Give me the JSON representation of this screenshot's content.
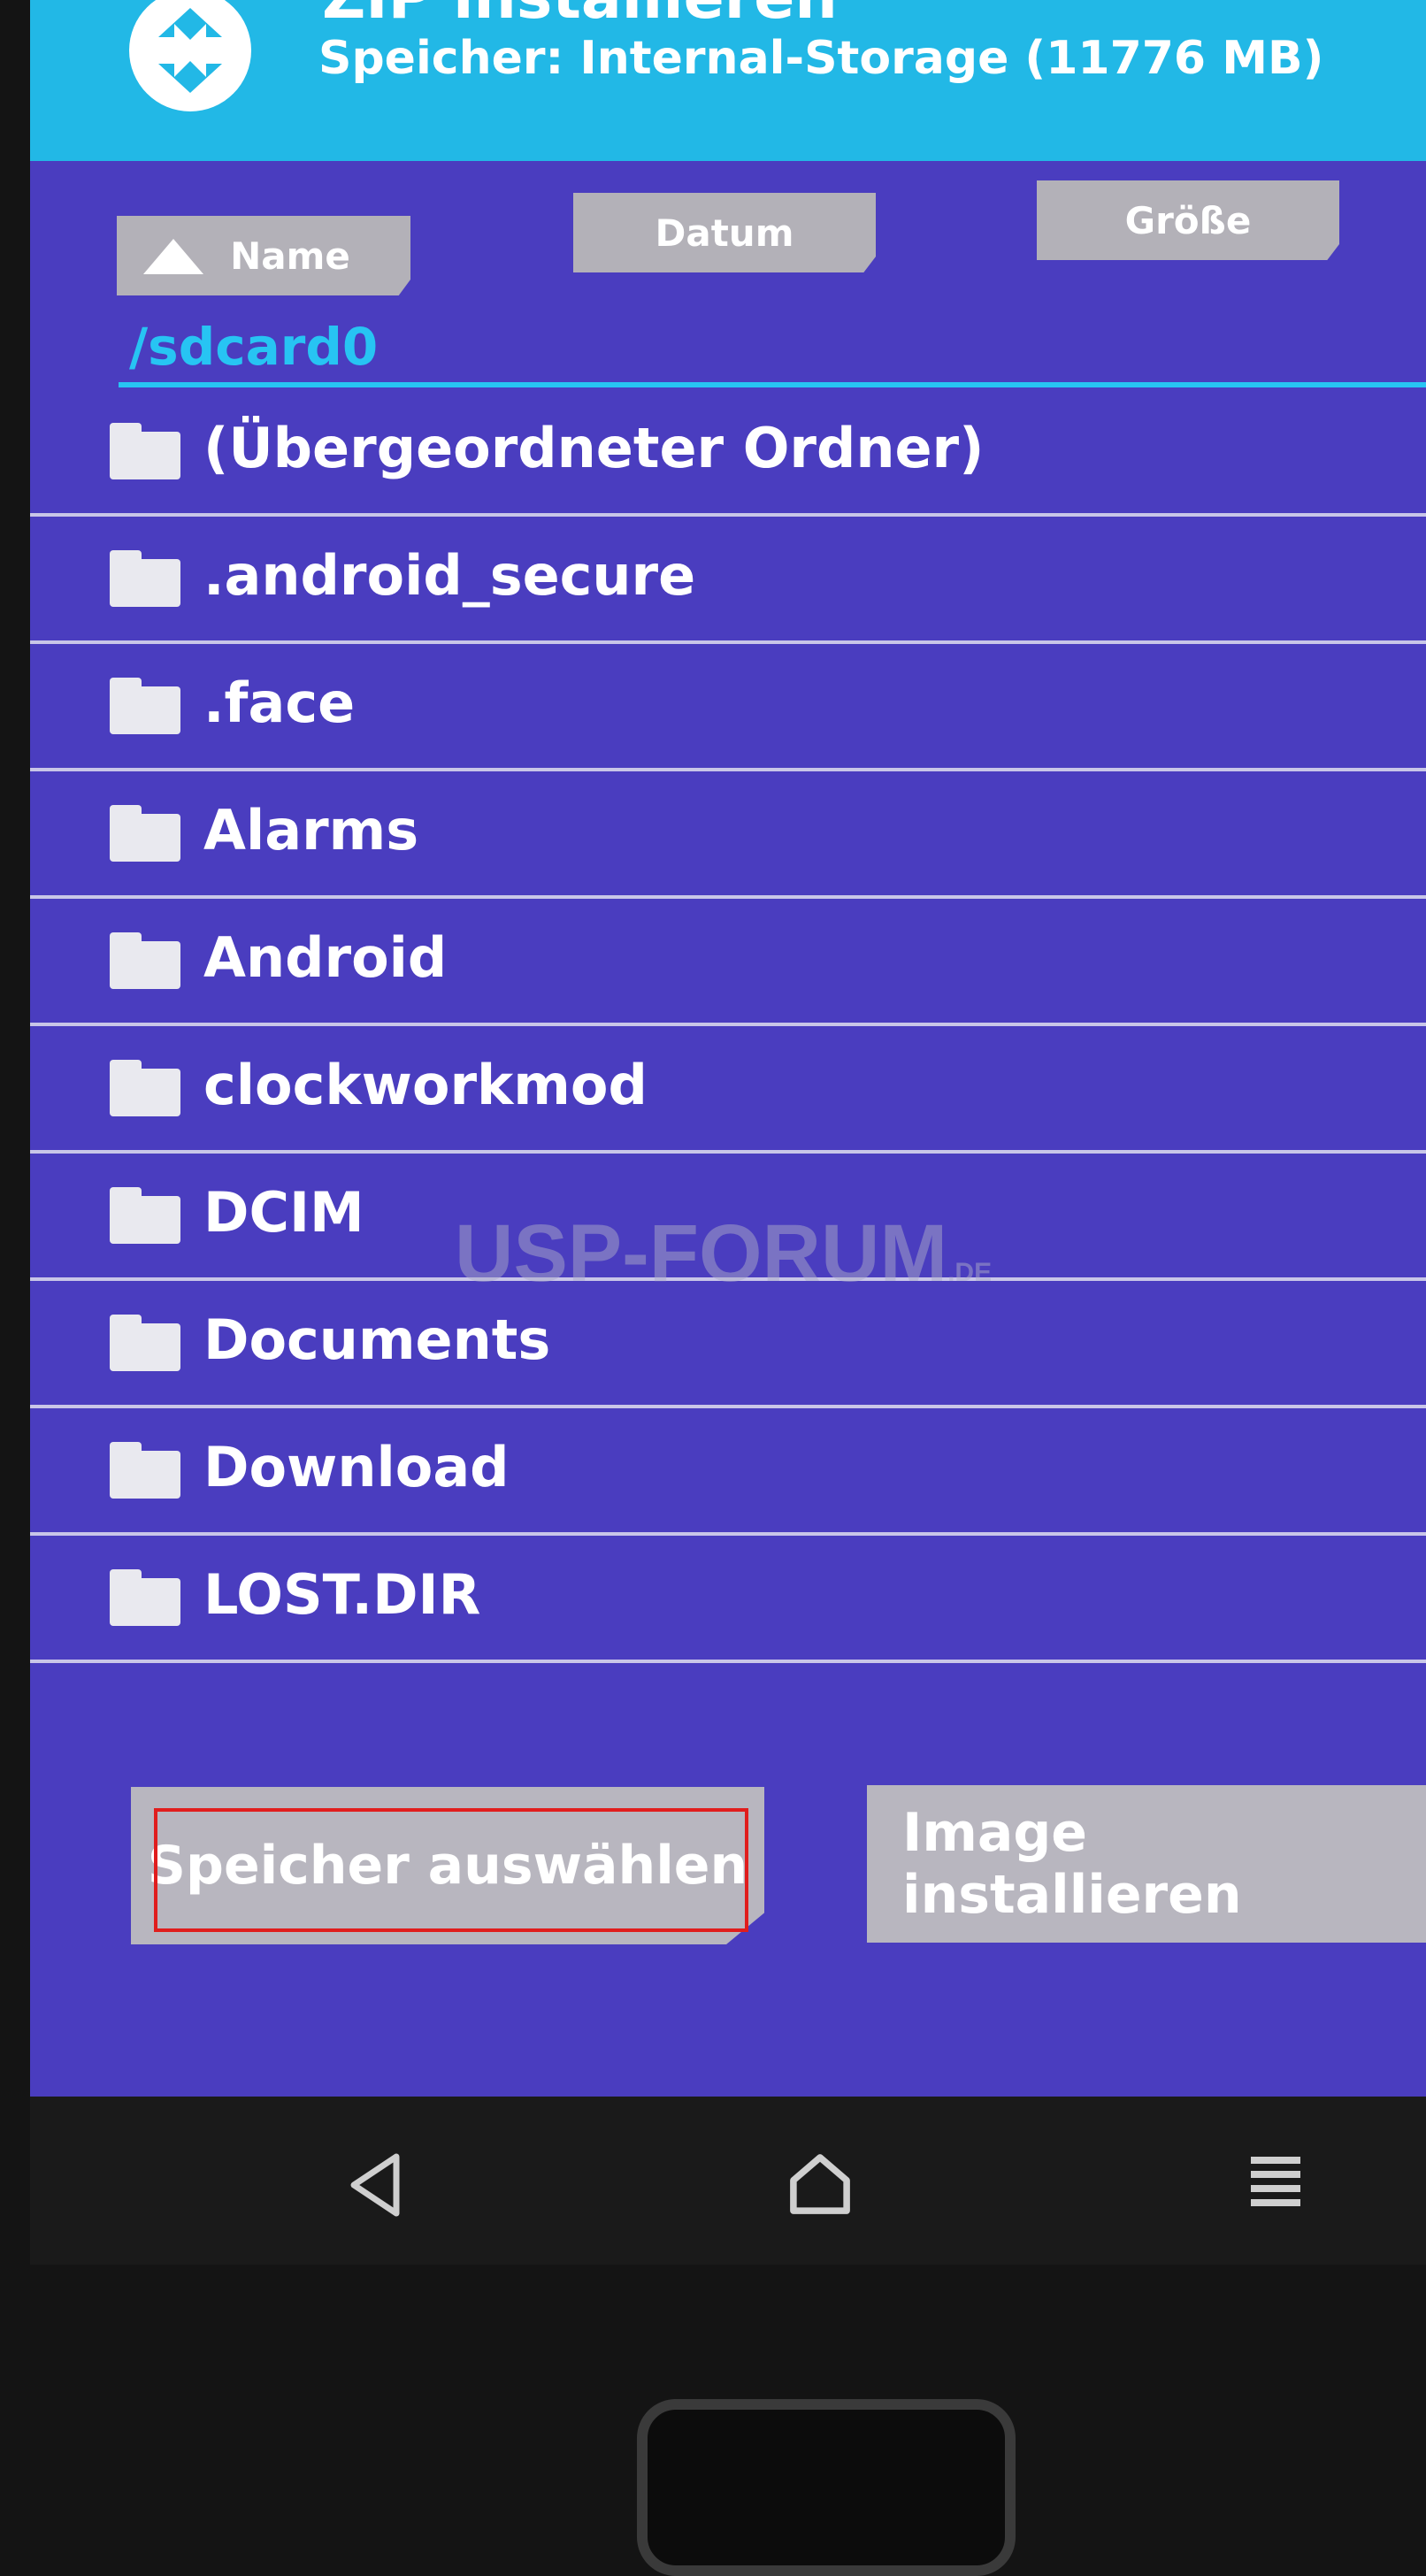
{
  "header": {
    "title": "ZIP installieren",
    "storage": "Speicher: Internal-Storage (11776 MB)"
  },
  "sort": {
    "name": "Name",
    "date": "Datum",
    "size": "Größe"
  },
  "path": "/sdcard0",
  "files": [
    {
      "label": "(Übergeordneter Ordner)"
    },
    {
      "label": ".android_secure"
    },
    {
      "label": ".face"
    },
    {
      "label": "Alarms"
    },
    {
      "label": "Android"
    },
    {
      "label": "clockworkmod"
    },
    {
      "label": "DCIM"
    },
    {
      "label": "Documents"
    },
    {
      "label": "Download"
    },
    {
      "label": "LOST.DIR"
    }
  ],
  "watermark": {
    "main": "USP-FORUM",
    "suffix": ".DE"
  },
  "buttons": {
    "select_storage": "Speicher auswählen",
    "install_image": "Image installieren"
  },
  "colors": {
    "header": "#22b8e6",
    "background": "#4a3dbf",
    "button": "#b8b6bf",
    "highlight": "#e01d1d"
  },
  "icons": [
    "twrp-logo-icon",
    "folder-icon",
    "back-icon",
    "home-icon",
    "menu-icon"
  ]
}
